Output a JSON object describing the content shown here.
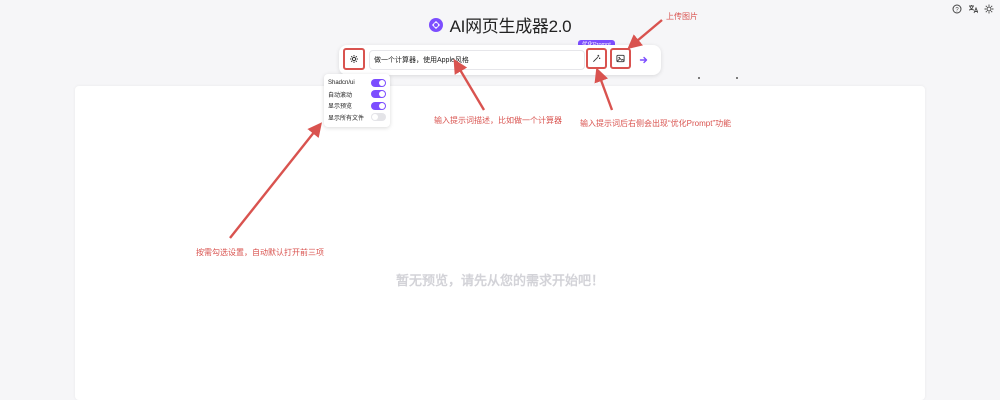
{
  "app": {
    "title": "AI网页生成器2.0"
  },
  "top_icons": [
    "help-icon",
    "translate-icon",
    "theme-icon"
  ],
  "input_bar": {
    "prompt_value": "做一个计算器，使用Apple风格",
    "tooltip": "优化Prompt"
  },
  "settings_menu": {
    "items": [
      {
        "label": "Shadcn/ui",
        "enabled": true
      },
      {
        "label": "自动滚动",
        "enabled": true
      },
      {
        "label": "显示预览",
        "enabled": true
      },
      {
        "label": "显示所有文件",
        "enabled": false
      }
    ]
  },
  "preview": {
    "empty_text": "暂无预览，请先从您的需求开始吧！"
  },
  "annotations": {
    "upload": "上传图片",
    "prompt_desc": "输入提示词描述，比如做一个计算器",
    "optimize": "输入提示词后右侧会出现“优化Prompt”功能",
    "settings": "按需勾选设置，自动默认打开前三项"
  },
  "colors": {
    "accent": "#7c4dff",
    "annotation": "#d9534f",
    "background": "#f6f6f8"
  }
}
